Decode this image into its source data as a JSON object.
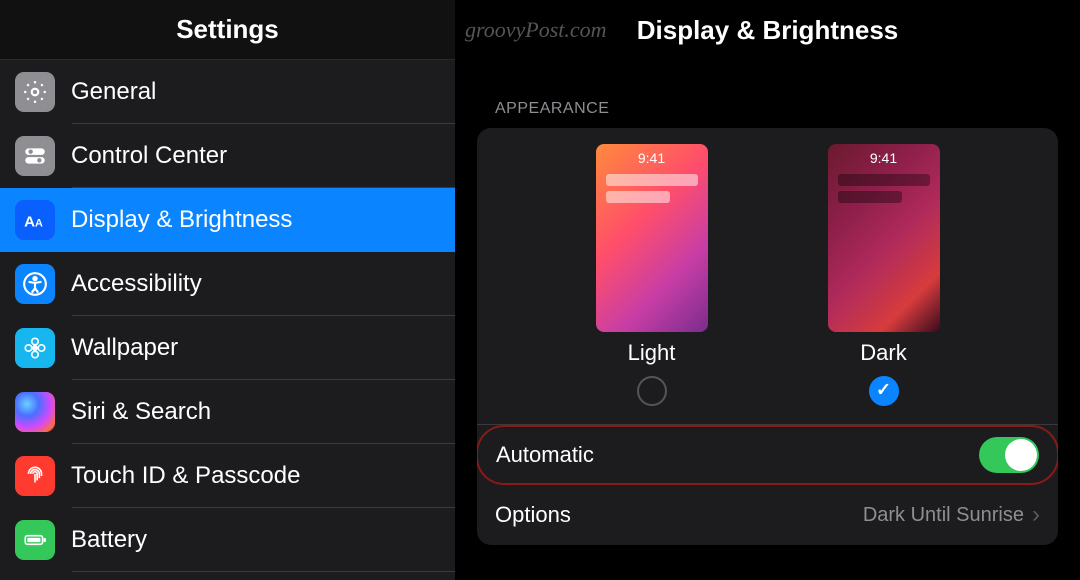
{
  "watermark": "groovyPost.com",
  "sidebar": {
    "title": "Settings",
    "items": [
      {
        "label": "General",
        "icon": "gear-icon",
        "iconBg": "#8e8e93"
      },
      {
        "label": "Control Center",
        "icon": "toggles-icon",
        "iconBg": "#8e8e93"
      },
      {
        "label": "Display & Brightness",
        "icon": "text-size-icon",
        "iconBg": "#0a5fff"
      },
      {
        "label": "Accessibility",
        "icon": "accessibility-icon",
        "iconBg": "#0a84ff"
      },
      {
        "label": "Wallpaper",
        "icon": "flower-icon",
        "iconBg": "#18b6ef"
      },
      {
        "label": "Siri & Search",
        "icon": "siri-icon",
        "iconBg": "#000"
      },
      {
        "label": "Touch ID & Passcode",
        "icon": "fingerprint-icon",
        "iconBg": "#ff3b30"
      },
      {
        "label": "Battery",
        "icon": "battery-icon",
        "iconBg": "#34c759"
      }
    ],
    "selectedIndex": 2
  },
  "content": {
    "title": "Display & Brightness",
    "sectionLabel": "APPEARANCE",
    "appearance": {
      "previewTime": "9:41",
      "options": [
        {
          "label": "Light",
          "theme": "light",
          "selected": false
        },
        {
          "label": "Dark",
          "theme": "dark",
          "selected": true
        }
      ]
    },
    "automatic": {
      "label": "Automatic",
      "enabled": true
    },
    "options": {
      "label": "Options",
      "value": "Dark Until Sunrise"
    }
  }
}
